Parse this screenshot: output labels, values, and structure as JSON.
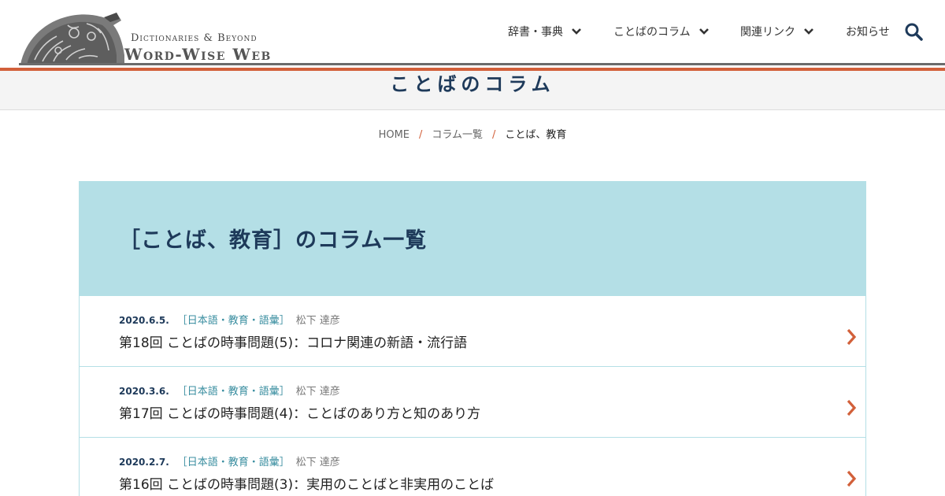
{
  "site": {
    "logo_subtitle": "Dictionaries & Beyond",
    "logo_title": "Word-Wise Web"
  },
  "nav": {
    "items": [
      {
        "label": "辞書・事典",
        "has_dropdown": true
      },
      {
        "label": "ことばのコラム",
        "has_dropdown": true
      },
      {
        "label": "関連リンク",
        "has_dropdown": true
      },
      {
        "label": "お知らせ",
        "has_dropdown": false
      }
    ],
    "search_icon": "search-icon"
  },
  "page": {
    "title": "ことばのコラム"
  },
  "breadcrumb": {
    "items": [
      "HOME",
      "コラム一覧",
      "ことば、教育"
    ],
    "separator": "/"
  },
  "list": {
    "title": "［ことば、教育］のコラム一覧",
    "rows": [
      {
        "date": "2020.6.5.",
        "category": "［日本語・教育・語彙］",
        "author": "松下 達彦",
        "title": "第18回 ことばの時事問題(5)：コロナ関連の新語・流行語"
      },
      {
        "date": "2020.3.6.",
        "category": "［日本語・教育・語彙］",
        "author": "松下 達彦",
        "title": "第17回 ことばの時事問題(4)：ことばのあり方と知のあり方"
      },
      {
        "date": "2020.2.7.",
        "category": "［日本語・教育・語彙］",
        "author": "松下 達彦",
        "title": "第16回 ことばの時事問題(3)：実用のことばと非実用のことば"
      }
    ]
  },
  "colors": {
    "accent_orange": "#d2603a",
    "navy": "#1e3a5a",
    "light_blue": "#b4dfe6",
    "teal_text": "#3a8ea0"
  }
}
